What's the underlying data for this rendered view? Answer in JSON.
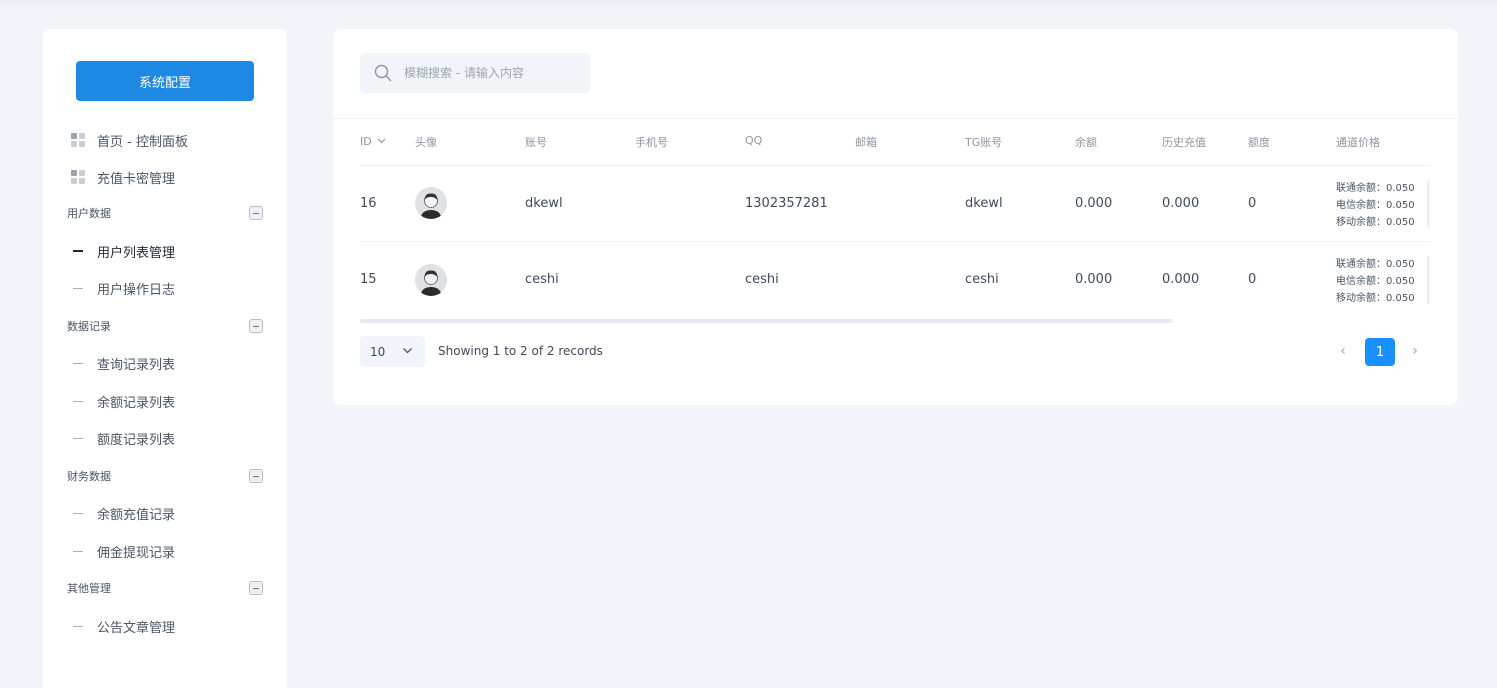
{
  "sidebar": {
    "config_button": "系统配置",
    "top_items": [
      {
        "label": "首页 - 控制面板"
      },
      {
        "label": "充值卡密管理"
      }
    ],
    "sections": [
      {
        "title": "用户数据",
        "items": [
          "用户列表管理",
          "用户操作日志"
        ]
      },
      {
        "title": "数据记录",
        "items": [
          "查询记录列表",
          "余额记录列表",
          "额度记录列表"
        ]
      },
      {
        "title": "财务数据",
        "items": [
          "余额充值记录",
          "佣金提现记录"
        ]
      },
      {
        "title": "其他管理",
        "items": [
          "公告文章管理"
        ]
      }
    ],
    "active_item": "用户列表管理"
  },
  "search": {
    "placeholder": "模糊搜索 - 请输入内容"
  },
  "table": {
    "headers": {
      "id": "ID",
      "avatar": "头像",
      "account": "账号",
      "phone": "手机号",
      "qq": "QQ",
      "email": "邮箱",
      "tg": "TG账号",
      "balance": "余额",
      "history": "历史充值",
      "quota": "额度",
      "price": "通道价格"
    },
    "rows": [
      {
        "id": "16",
        "account": "dkewl",
        "phone": "",
        "qq": "1302357281",
        "email": "",
        "tg": "dkewl",
        "balance": "0.000",
        "history": "0.000",
        "quota": "0",
        "prices": [
          "联通余额：0.050",
          "电信余额：0.050",
          "移动余额：0.050"
        ]
      },
      {
        "id": "15",
        "account": "ceshi",
        "phone": "",
        "qq": "ceshi",
        "email": "",
        "tg": "ceshi",
        "balance": "0.000",
        "history": "0.000",
        "quota": "0",
        "prices": [
          "联通余额：0.050",
          "电信余额：0.050",
          "移动余额：0.050"
        ]
      }
    ]
  },
  "pagination": {
    "page_size": "10",
    "summary": "Showing 1 to 2 of 2 records",
    "current_page": "1",
    "prev": "‹",
    "next": "›"
  },
  "colors": {
    "accent": "#1e88e5",
    "page_active": "#1890ff",
    "background": "#f1f4f8"
  }
}
